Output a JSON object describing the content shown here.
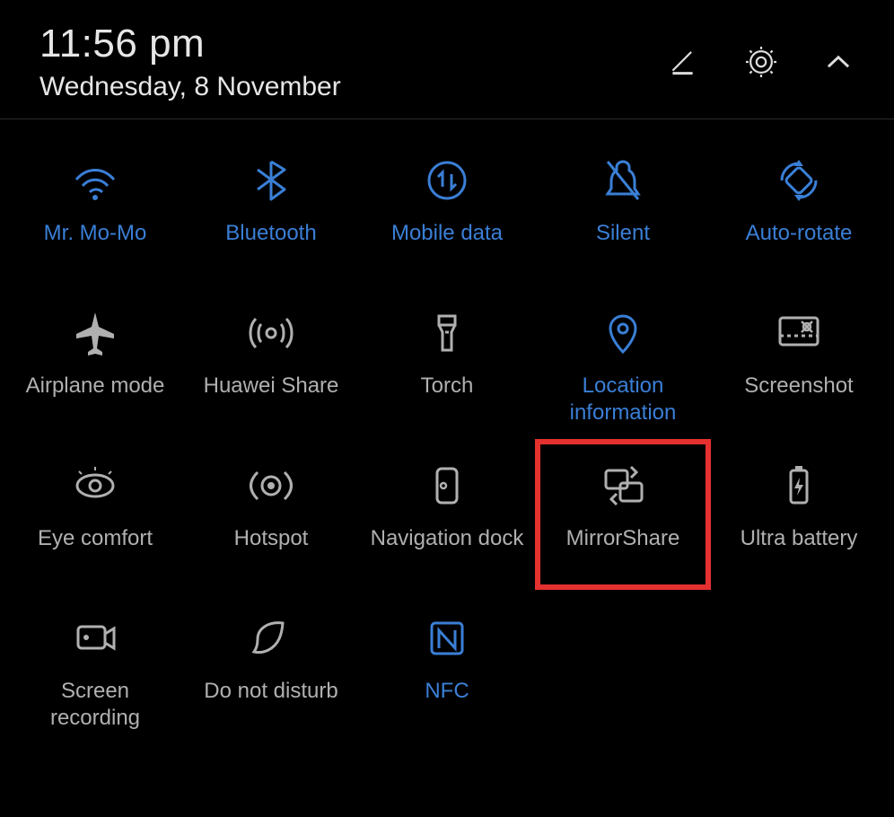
{
  "header": {
    "time": "11:56 pm",
    "date": "Wednesday, 8 November",
    "edit_icon": "edit-icon",
    "settings_icon": "gear-icon",
    "collapse_icon": "chevron-up-icon"
  },
  "tiles": [
    {
      "id": "wifi",
      "label": "Mr. Mo-Mo",
      "icon": "wifi-icon",
      "active": true,
      "highlighted": false
    },
    {
      "id": "bluetooth",
      "label": "Bluetooth",
      "icon": "bluetooth-icon",
      "active": true,
      "highlighted": false
    },
    {
      "id": "mobile-data",
      "label": "Mobile data",
      "icon": "mobile-data-icon",
      "active": true,
      "highlighted": false
    },
    {
      "id": "silent",
      "label": "Silent",
      "icon": "silent-icon",
      "active": true,
      "highlighted": false
    },
    {
      "id": "auto-rotate",
      "label": "Auto-rotate",
      "icon": "auto-rotate-icon",
      "active": true,
      "highlighted": false
    },
    {
      "id": "airplane",
      "label": "Airplane mode",
      "icon": "airplane-icon",
      "active": false,
      "highlighted": false
    },
    {
      "id": "huawei-share",
      "label": "Huawei Share",
      "icon": "huawei-share-icon",
      "active": false,
      "highlighted": false
    },
    {
      "id": "torch",
      "label": "Torch",
      "icon": "torch-icon",
      "active": false,
      "highlighted": false
    },
    {
      "id": "location",
      "label": "Location information",
      "icon": "location-icon",
      "active": true,
      "highlighted": false
    },
    {
      "id": "screenshot",
      "label": "Screenshot",
      "icon": "screenshot-icon",
      "active": false,
      "highlighted": false
    },
    {
      "id": "eye-comfort",
      "label": "Eye comfort",
      "icon": "eye-comfort-icon",
      "active": false,
      "highlighted": false
    },
    {
      "id": "hotspot",
      "label": "Hotspot",
      "icon": "hotspot-icon",
      "active": false,
      "highlighted": false
    },
    {
      "id": "nav-dock",
      "label": "Navigation dock",
      "icon": "nav-dock-icon",
      "active": false,
      "highlighted": false
    },
    {
      "id": "mirrorshare",
      "label": "MirrorShare",
      "icon": "mirrorshare-icon",
      "active": false,
      "highlighted": true
    },
    {
      "id": "ultra-battery",
      "label": "Ultra battery",
      "icon": "ultra-battery-icon",
      "active": false,
      "highlighted": false
    },
    {
      "id": "screen-rec",
      "label": "Screen recording",
      "icon": "screen-rec-icon",
      "active": false,
      "highlighted": false
    },
    {
      "id": "dnd",
      "label": "Do not disturb",
      "icon": "dnd-icon",
      "active": false,
      "highlighted": false
    },
    {
      "id": "nfc",
      "label": "NFC",
      "icon": "nfc-icon",
      "active": true,
      "highlighted": false
    }
  ]
}
